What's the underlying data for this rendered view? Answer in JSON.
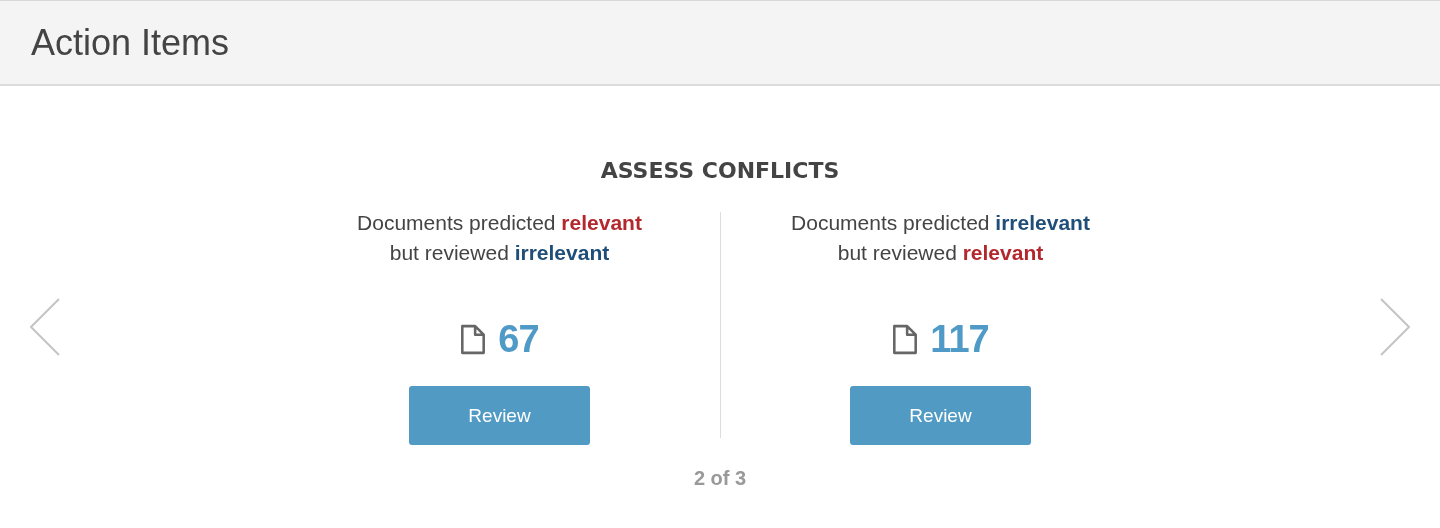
{
  "header": {
    "title": "Action Items"
  },
  "section": {
    "title": "ASSESS CONFLICTS"
  },
  "cards": [
    {
      "description": [
        [
          {
            "kind": "plain",
            "text": "Documents predicted "
          },
          {
            "kind": "relevant",
            "text": "relevant"
          }
        ],
        [
          {
            "kind": "plain",
            "text": "but reviewed "
          },
          {
            "kind": "irrelevant",
            "text": "irrelevant"
          }
        ]
      ],
      "count": "67",
      "button": "Review"
    },
    {
      "description": [
        [
          {
            "kind": "plain",
            "text": "Documents predicted "
          },
          {
            "kind": "irrelevant",
            "text": "irrelevant"
          }
        ],
        [
          {
            "kind": "plain",
            "text": "but reviewed "
          },
          {
            "kind": "relevant",
            "text": "relevant"
          }
        ]
      ],
      "count": "117",
      "button": "Review"
    }
  ],
  "pager": "2 of 3"
}
